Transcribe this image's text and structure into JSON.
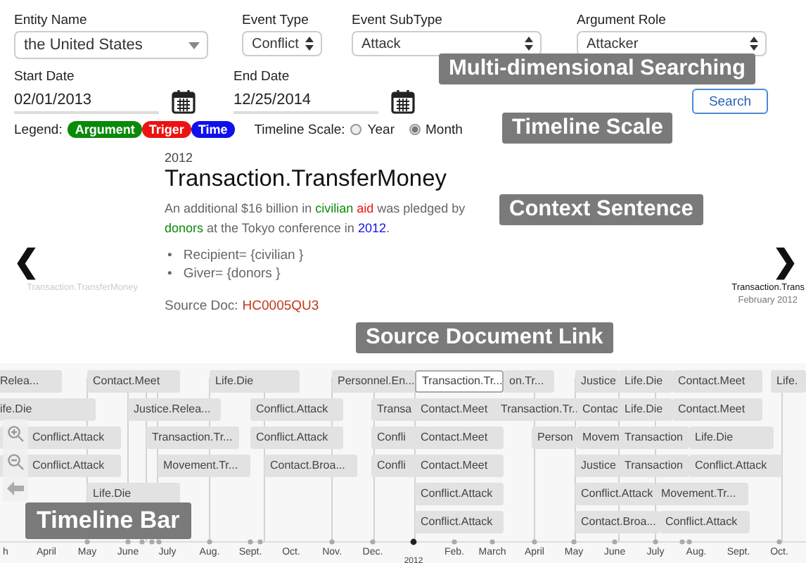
{
  "search": {
    "fields": [
      {
        "label": "Entity Name",
        "kind": "combo",
        "value": "the United States"
      },
      {
        "label": "Event Type",
        "kind": "select",
        "value": "Conflict"
      },
      {
        "label": "Event SubType",
        "kind": "select",
        "value": "Attack"
      },
      {
        "label": "Argument Role",
        "kind": "select",
        "value": "Attacker"
      }
    ],
    "dates": [
      {
        "label": "Start Date",
        "value": "02/01/2013"
      },
      {
        "label": "End Date",
        "value": "12/25/2014"
      }
    ],
    "button": "Search"
  },
  "legend": {
    "label": "Legend:",
    "items": [
      {
        "text": "Argument",
        "color": "#0a8a0a"
      },
      {
        "text": "Triger",
        "color": "#ee1111"
      },
      {
        "text": "Time",
        "color": "#1010ee"
      }
    ]
  },
  "timeline_scale": {
    "label": "Timeline Scale:",
    "options": [
      {
        "label": "Year",
        "selected": false
      },
      {
        "label": "Month",
        "selected": true
      }
    ]
  },
  "event": {
    "year": "2012",
    "title": "Transaction.TransferMoney",
    "sentence": [
      {
        "kind": "plain",
        "text": "An additional $16 billion in "
      },
      {
        "kind": "argument",
        "text": "civilian "
      },
      {
        "kind": "trigger",
        "text": "aid"
      },
      {
        "kind": "plain",
        "text": " was pledged by "
      },
      {
        "kind": "argument",
        "text": "donors"
      },
      {
        "kind": "plain",
        "text": " at the Tokyo conference in "
      },
      {
        "kind": "time",
        "text": "2012"
      },
      {
        "kind": "plain",
        "text": "."
      }
    ],
    "arguments": [
      {
        "bullet": "•",
        "text": "Recipient= {civilian }"
      },
      {
        "bullet": "•",
        "text": "Giver= {donors }"
      }
    ],
    "source_label": "Source Doc:",
    "source_link": "HC0005QU3"
  },
  "previous": {
    "arrow": "❮",
    "title": "Transaction.TransferMoney"
  },
  "next": {
    "arrow": "❯",
    "title": "Transaction.Trans",
    "date": "February 2012"
  },
  "timeline": {
    "lanes": [
      [
        {
          "label": "Relea...",
          "selected": false
        },
        {
          "label": "Contact.Meet",
          "selected": false
        },
        {
          "label": "Life.Die",
          "selected": false
        },
        {
          "label": "Personnel.En...",
          "selected": false
        },
        {
          "label": "Transaction.Tr...",
          "selected": true
        },
        {
          "label": "on.Tr...",
          "selected": false
        },
        {
          "label": "Justice",
          "selected": false
        },
        {
          "label": "Life.Die",
          "selected": false
        },
        {
          "label": "Contact.Meet",
          "selected": false
        },
        {
          "label": "Life.",
          "selected": false
        }
      ],
      [
        {
          "label": "ife.Die",
          "selected": false
        },
        {
          "label": "Justice.Relea...",
          "selected": false
        },
        {
          "label": "Conflict.Attack",
          "selected": false
        },
        {
          "label": "Transa",
          "selected": false
        },
        {
          "label": "Contact.Meet",
          "selected": false
        },
        {
          "label": "Transaction.Tr..",
          "selected": false
        },
        {
          "label": "Contac",
          "selected": false
        },
        {
          "label": "Life.Die",
          "selected": false
        },
        {
          "label": "Contact.Meet",
          "selected": false
        }
      ],
      [
        {
          "label": "Conflict.Attack",
          "selected": false
        },
        {
          "label": "Transaction.Tr...",
          "selected": false
        },
        {
          "label": "Conflict.Attack",
          "selected": false
        },
        {
          "label": "Confli",
          "selected": false
        },
        {
          "label": "Contact.Meet",
          "selected": false
        },
        {
          "label": "Person",
          "selected": false
        },
        {
          "label": "Movem",
          "selected": false
        },
        {
          "label": "Transaction",
          "selected": false
        },
        {
          "label": "Life.Die",
          "selected": false
        }
      ],
      [
        {
          "label": "Conflict.Attack",
          "selected": false
        },
        {
          "label": "Movement.Tr...",
          "selected": false
        },
        {
          "label": "Contact.Broa...",
          "selected": false
        },
        {
          "label": "Confli",
          "selected": false
        },
        {
          "label": "Contact.Meet",
          "selected": false
        },
        {
          "label": "Justice",
          "selected": false
        },
        {
          "label": "Transaction",
          "selected": false
        },
        {
          "label": "Conflict.Attack",
          "selected": false
        }
      ],
      [
        {
          "label": "Life.Die",
          "selected": false
        },
        {
          "label": "Conflict.Attack",
          "selected": false
        },
        {
          "label": "Conflict.Attack",
          "selected": false
        },
        {
          "label": "Movement.Tr...",
          "selected": false
        }
      ],
      [
        {
          "label": "Conflict.Attack",
          "selected": false
        },
        {
          "label": "Contact.Broa...",
          "selected": false
        },
        {
          "label": "Conflict.Attack",
          "selected": false
        }
      ]
    ],
    "axis_labels": [
      "h",
      "April",
      "May",
      "June",
      "July",
      "Aug.",
      "Sept.",
      "Oct.",
      "Nov.",
      "Dec.",
      "2012",
      "Feb.",
      "March",
      "April",
      "May",
      "June",
      "July",
      "Aug.",
      "Sept.",
      "Oct."
    ]
  },
  "callouts": [
    "Multi-dimensional Searching",
    "Timeline Scale",
    "Context Sentence",
    "Source Document Link",
    "Timeline Bar"
  ]
}
